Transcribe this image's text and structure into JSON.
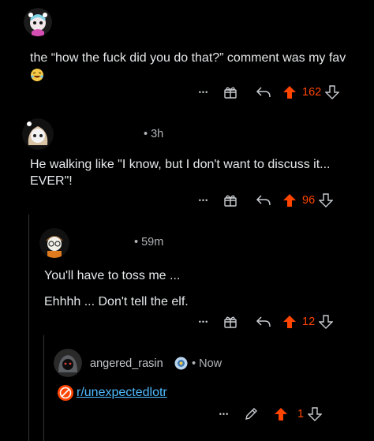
{
  "colors": {
    "upvote": "#ff4500",
    "link": "#4fbcff",
    "background": "#000000"
  },
  "comments": [
    {
      "text": "the “how the fuck did you do that?” comment was my fav",
      "emoji": "laughing-emoji",
      "votes": "162"
    },
    {
      "time": "3h",
      "text": "He walking like \"I know, but I don't want to discuss it... EVER\"!",
      "votes": "96"
    },
    {
      "time": "59m",
      "line1": "You'll have to toss me ...",
      "line2": "Ehhhh ... Don't tell the elf.",
      "votes": "12"
    },
    {
      "username": "angered_rasin",
      "time": "Now",
      "subreddit": "r/unexpectedlotr",
      "votes": "1"
    }
  ],
  "actions": {
    "more": "•••"
  }
}
